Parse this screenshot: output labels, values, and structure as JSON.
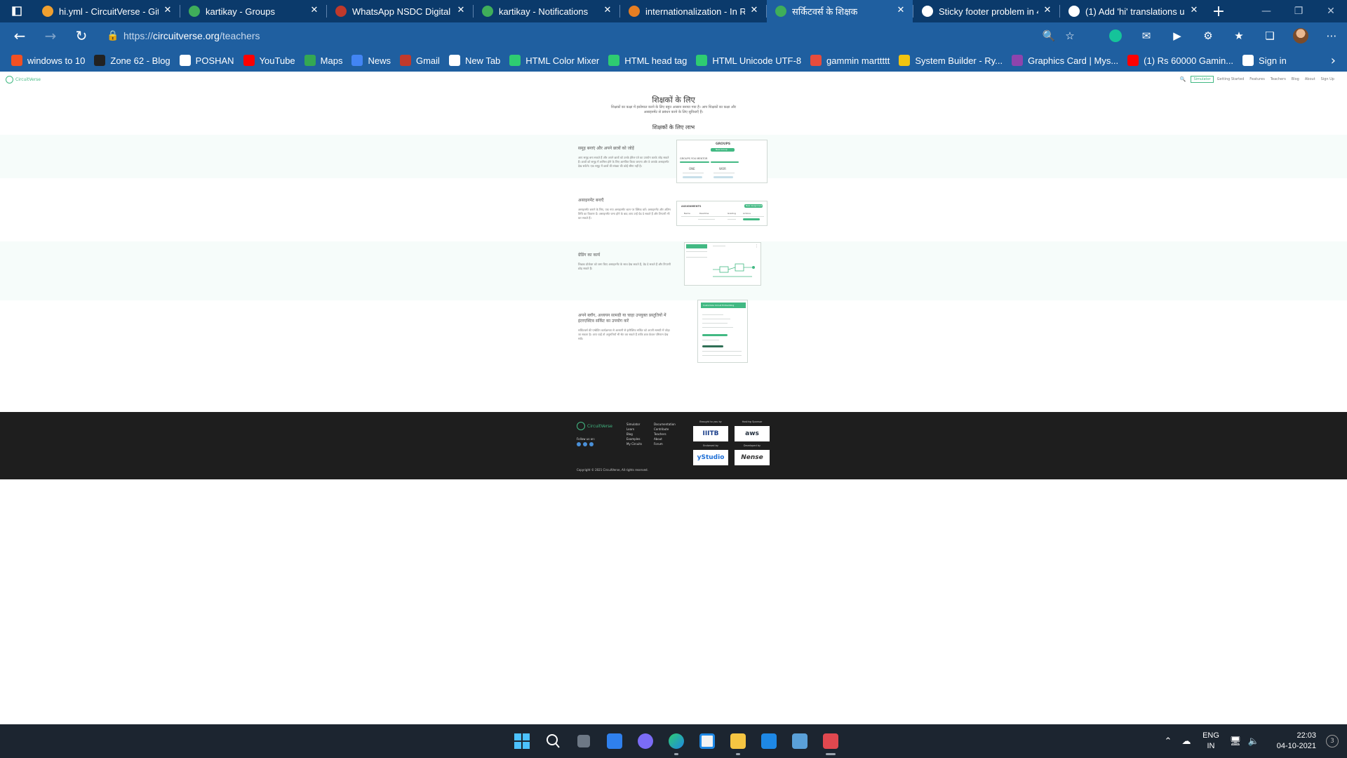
{
  "browser": {
    "tabs": [
      {
        "title": "hi.yml - CircuitVerse - Gitp",
        "color": "#f0a030"
      },
      {
        "title": "kartikay - Groups",
        "color": "#3fae5a"
      },
      {
        "title": "WhatsApp NSDC Digital Sk",
        "color": "#c0392b"
      },
      {
        "title": "kartikay - Notifications",
        "color": "#3fae5a"
      },
      {
        "title": "internationalization - In Ra",
        "color": "#e67e22"
      },
      {
        "title": "सर्किटवर्स के शिक्षक",
        "color": "#3fae5a"
      },
      {
        "title": "Sticky footer problem in 4(",
        "color": "#ffffff"
      },
      {
        "title": "(1) Add 'hi' translations usi",
        "color": "#ffffff"
      }
    ],
    "url_scheme": "https://",
    "url_host": "circuitverse.org",
    "url_path": "/teachers",
    "bookmarks": [
      {
        "label": "windows to 10",
        "color": "#f25022"
      },
      {
        "label": "Zone 62 - Blog",
        "color": "#222222"
      },
      {
        "label": "POSHAN",
        "color": "#ffffff"
      },
      {
        "label": "YouTube",
        "color": "#ff0000"
      },
      {
        "label": "Maps",
        "color": "#34a853"
      },
      {
        "label": "News",
        "color": "#4285f4"
      },
      {
        "label": "Gmail",
        "color": "#c0392b"
      },
      {
        "label": "New Tab",
        "color": "#ffffff"
      },
      {
        "label": "HTML Color Mixer",
        "color": "#2ecc71"
      },
      {
        "label": "HTML head tag",
        "color": "#2ecc71"
      },
      {
        "label": "HTML Unicode UTF-8",
        "color": "#2ecc71"
      },
      {
        "label": "gammin marttttt",
        "color": "#e74c3c"
      },
      {
        "label": "System Builder - Ry...",
        "color": "#f1c40f"
      },
      {
        "label": "Graphics Card | Mys...",
        "color": "#8e44ad"
      },
      {
        "label": "(1) Rs 60000 Gamin...",
        "color": "#ff0000"
      },
      {
        "label": "Sign in",
        "color": "#ffffff"
      }
    ]
  },
  "site": {
    "logo": "CircuitVerse",
    "nav": {
      "simulator": "Simulator",
      "links": [
        "Getting Started",
        "Features",
        "Teachers",
        "Blog",
        "About",
        "Sign Up"
      ]
    },
    "hero_title": "शिक्षकों के लिए",
    "hero_subtitle": "शिक्षकों का कक्षा में इस्तेमाल करने के लिए बहुत आसान बनाया गया है। आप शिक्षकों का कक्षा और असाइनमेंट से प्रबंधन करने के लिए सुविधाएँ हैं।",
    "benefits_title": "शिक्षकों के लिए लाभ",
    "features": [
      {
        "title": "समूह बनाएं और अपने छात्रों को जोड़ें",
        "text": "आप समूह बना सकते हैं और अपने छात्रों को उनके ईमेल पते का उपयोग करके जोड़ सकते हैं। छात्रों को समूह में शामिल होने के लिए आमंत्रित किया जाएगा और वे आपके असाइनमेंट देख सकेंगे। एक समूह में छात्रों की संख्या की कोई सीमा नहीं है।"
      },
      {
        "title": "असाइनमेंट बनाएँ",
        "text": "असाइनमेंट बनाने के लिए, एक नया असाइनमेंट बटन पर क्लिक करें। असाइनमेंट और अंतिम तिथि का विवरण दें। असाइनमेंट जमा होने के बाद आप उन्हें ग्रेड दे सकते हैं और टिप्पणी भी कर सकते हैं।"
      },
      {
        "title": "ग्रेडिंग का कार्य",
        "text": "शिक्षक प्रोजेक्ट को जमा किए असाइनमेंट के साथ देख सकते हैं, ग्रेड दे सकते हैं और टिप्पणी छोड़ सकते हैं।"
      },
      {
        "title": "अपने ब्लॉग, अध्ययन सामग्री या चाहा उपयुक्त प्रस्तुतियों में इंटरएक्टिव सर्किट का उपयोग करें",
        "text": "सर्किटवर्स की एम्बेडिंग कार्यक्षमता से आसानी से इंटरैक्टिव सर्किट को अपनी सामग्री में जोड़ा जा सकता है। आप चाहें तो अनुमतियाँ भी सेट कर सकते हैं ताकि छात्र केवल परिणाम देख सकें।"
      }
    ],
    "shots": {
      "groups_title": "GROUPS",
      "groups_new": "New Group",
      "groups_you": "GROUPS YOU MENTOR",
      "group_a": "ONE",
      "group_b": "WOR",
      "assign_header": "ASSIGNMENTS",
      "assign_btn": "New Assignment",
      "assign_cols": [
        "Name",
        "Deadline",
        "Grading",
        "Actions"
      ],
      "embed_title": "Customize Circuit Embedding"
    },
    "footer": {
      "logo": "CircuitVerse",
      "follow": "Follow us on:",
      "col1": [
        "Simulator",
        "Learn",
        "Blog",
        "Examples",
        "My Circuits"
      ],
      "col2": [
        "Documentation",
        "Contribute",
        "Teachers",
        "About",
        "Forum"
      ],
      "brought_by": "Brought to you by",
      "hosting": "Hosting Sponsor",
      "endorsed": "Endorsed by",
      "developed": "Developed by",
      "badges": [
        "IIITB",
        "aws",
        "yStudio",
        "Nense"
      ],
      "copyright": "Copyright © 2021 CircuitVerse, All rights reserved."
    }
  },
  "taskbar": {
    "lang_top": "ENG",
    "lang_bottom": "IN",
    "time": "22:03",
    "date": "04-10-2021",
    "notif_count": "3"
  }
}
